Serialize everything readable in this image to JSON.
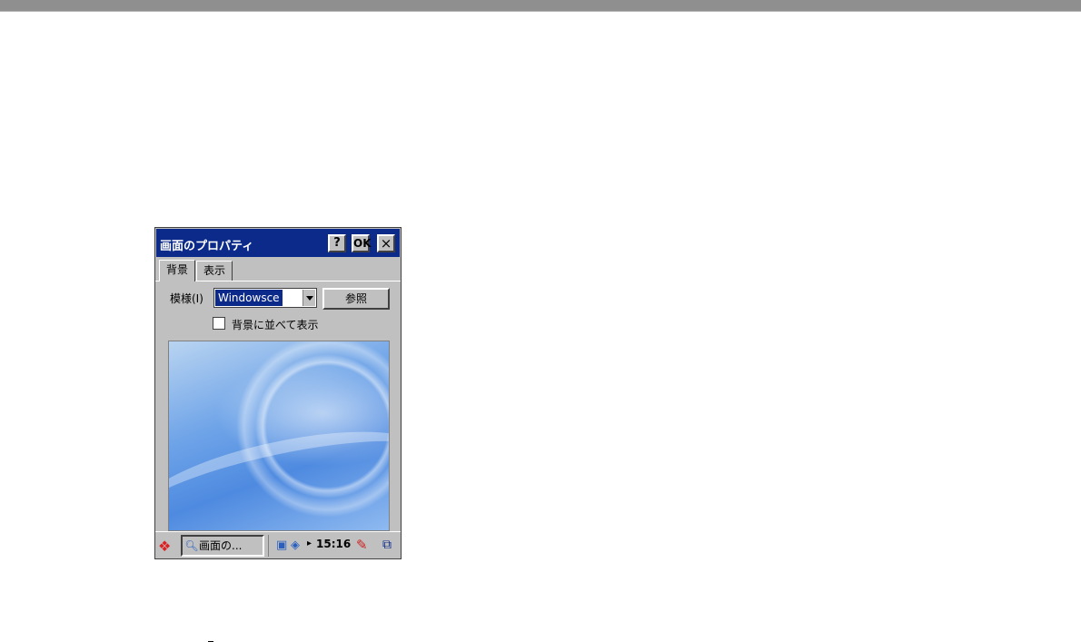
{
  "window": {
    "title": "画面のプロパティ",
    "help_label": "?",
    "ok_label": "OK",
    "close_label": "×"
  },
  "tabs": [
    {
      "label": "背景",
      "active": true
    },
    {
      "label": "表示",
      "active": false
    }
  ],
  "background_tab": {
    "pattern_label": "模様(I)",
    "pattern_value": "Windowsce",
    "browse_label": "参照",
    "tile_label": "背景に並べて表示",
    "tile_checked": false
  },
  "taskbar": {
    "task_label": "画面の...",
    "clock": "15:16"
  },
  "colors": {
    "title_bar": "#0b2a8a",
    "chrome": "#c0c0c0"
  }
}
